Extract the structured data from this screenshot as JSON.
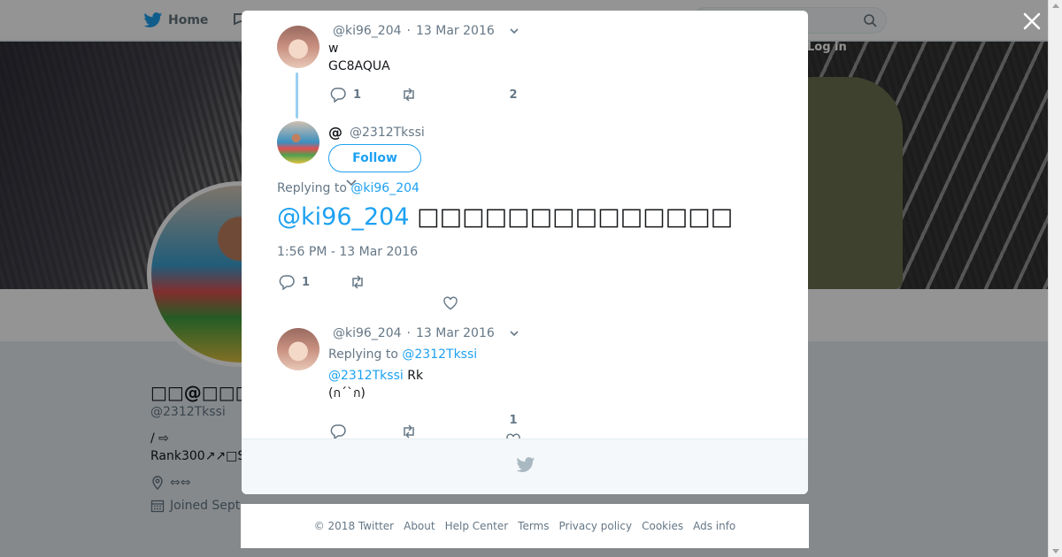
{
  "background": {
    "nav": {
      "home_label": "Home",
      "login_label": "Log in"
    },
    "profile": {
      "name": "□□@□□□",
      "handle": "@2312Tkssi",
      "bio_line1": " / ⇨",
      "bio_line2": "Rank300↗↗□S",
      "location": "⇔⇔",
      "joined": "Joined Sept"
    }
  },
  "modal": {
    "tweet1": {
      "handle": "@ki96_204",
      "separator": "·",
      "date": "13 Mar 2016",
      "text_line1": "w",
      "text_line2": "GC8AQUA",
      "reply_count": "1",
      "like_count": "2"
    },
    "main_tweet": {
      "display_name": "@",
      "handle": "@2312Tkssi",
      "follow_label": "Follow",
      "replying_prefix": "Replying to",
      "replying_to": "@ki96_204",
      "body_mention": "@ki96_204",
      "body_text": "□□□□□□□□□□□□□□",
      "timestamp": "1:56 PM - 13 Mar 2016",
      "reply_count": "1"
    },
    "reply_tweet": {
      "handle": "@ki96_204",
      "separator": "·",
      "date": "13 Mar 2016",
      "replying_prefix": "Replying to",
      "replying_to": "@2312Tkssi",
      "body_mention": "@2312Tkssi",
      "body_text": " Rk",
      "body_line2": "(ก´`ก)",
      "like_count": "1"
    }
  },
  "footer": {
    "copyright": "© 2018 Twitter",
    "links": [
      "About",
      "Help Center",
      "Terms",
      "Privacy policy",
      "Cookies",
      "Ads info"
    ]
  },
  "colors": {
    "accent": "#1da1f2",
    "text_secondary": "#657786",
    "thread_line": "#9ad0f0",
    "overlay": "rgba(0,0,0,0.42)"
  }
}
